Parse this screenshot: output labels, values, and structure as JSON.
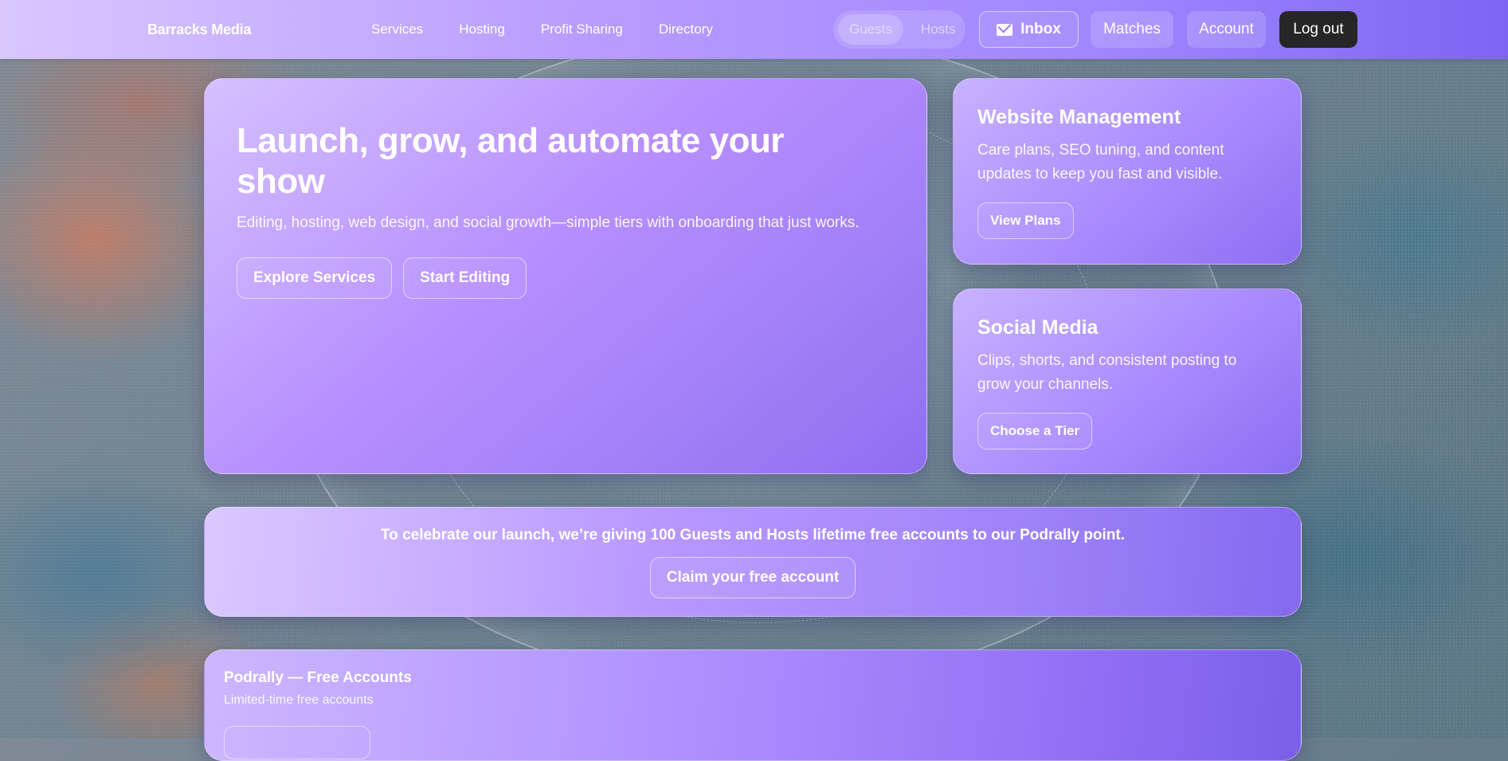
{
  "brand": "Barracks Media",
  "nav": {
    "links": [
      "Services",
      "Hosting",
      "Profit Sharing",
      "Directory"
    ],
    "role_toggle": [
      "Guests",
      "Hosts"
    ],
    "inbox_label": "Inbox",
    "matches_label": "Matches",
    "account_label": "Account",
    "logout_label": "Log out"
  },
  "hero": {
    "title": "Launch, grow, and automate your show",
    "subtitle": "Editing, hosting, web design, and social growth—simple tiers with onboarding that just works.",
    "primary_label": "Explore Services",
    "secondary_label": "Start Editing"
  },
  "cards": [
    {
      "title": "Website Management",
      "text": "Care plans, SEO tuning, and content updates to keep you fast and visible.",
      "button": "View Plans"
    },
    {
      "title": "Social Media",
      "text": "Clips, shorts, and consistent posting to grow your channels.",
      "button": "Choose a Tier"
    }
  ],
  "promo": {
    "text_before": "To celebrate our launch, we’re giving ",
    "highlight": "100",
    "text_after": " Guests and Hosts lifetime free accounts to our Podrally point.",
    "button": "Claim your free account"
  },
  "podrally": {
    "title": "Podrally — Free Accounts",
    "subtitle": "Limited-time free accounts"
  },
  "icons": {
    "inbox": "mail-icon"
  },
  "colors": {
    "accent": "#a98bff",
    "logout_bg": "#262626"
  }
}
